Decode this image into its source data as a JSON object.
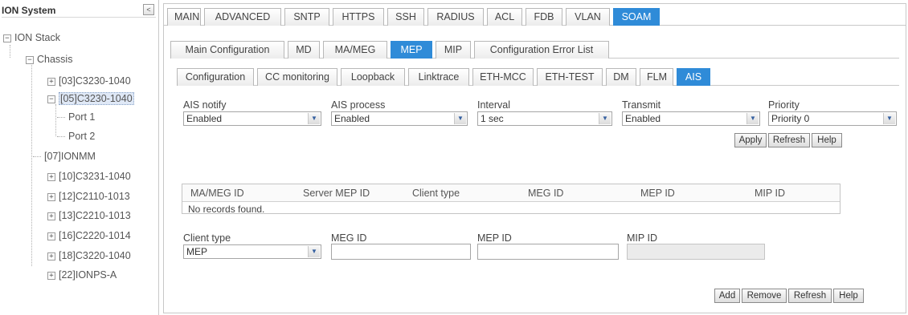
{
  "tree": {
    "title": "ION System",
    "collapse_icon": "<",
    "stack_label": "ION Stack",
    "chassis_label": "Chassis",
    "items": [
      {
        "label": "[03]C3230-1040",
        "expander": "+"
      },
      {
        "label": "[05]C3230-1040",
        "expander": "−",
        "selected": true
      },
      {
        "label": "Port 1"
      },
      {
        "label": "Port 2"
      },
      {
        "label": "[07]IONMM"
      },
      {
        "label": "[10]C3231-1040",
        "expander": "+"
      },
      {
        "label": "[12]C2110-1013",
        "expander": "+"
      },
      {
        "label": "[13]C2210-1013",
        "expander": "+"
      },
      {
        "label": "[16]C2220-1014",
        "expander": "+"
      },
      {
        "label": "[18]C3220-1040",
        "expander": "+"
      },
      {
        "label": "[22]IONPS-A",
        "expander": "+"
      }
    ]
  },
  "top_tabs": [
    "MAIN",
    "ADVANCED",
    "SNTP",
    "HTTPS",
    "SSH",
    "RADIUS",
    "ACL",
    "FDB",
    "VLAN",
    "SOAM"
  ],
  "top_tabs_active": "SOAM",
  "sub_tabs": [
    "Main Configuration",
    "MD",
    "MA/MEG",
    "MEP",
    "MIP",
    "Configuration Error List"
  ],
  "sub_tabs_active": "MEP",
  "mep_tabs": [
    "Configuration",
    "CC monitoring",
    "Loopback",
    "Linktrace",
    "ETH-MCC",
    "ETH-TEST",
    "DM",
    "FLM",
    "AIS"
  ],
  "mep_tabs_active": "AIS",
  "ais_form": {
    "ais_notify": {
      "label": "AIS notify",
      "value": "Enabled"
    },
    "ais_process": {
      "label": "AIS process",
      "value": "Enabled"
    },
    "interval": {
      "label": "Interval",
      "value": "1 sec"
    },
    "transmit": {
      "label": "Transmit",
      "value": "Enabled"
    },
    "priority": {
      "label": "Priority",
      "value": "Priority 0"
    },
    "buttons": {
      "apply": "Apply",
      "refresh": "Refresh",
      "help": "Help"
    }
  },
  "records_table": {
    "columns": [
      "MA/MEG ID",
      "Server MEP ID",
      "Client type",
      "MEG ID",
      "MEP ID",
      "MIP ID"
    ],
    "empty_text": "No records found."
  },
  "add_form": {
    "client_type": {
      "label": "Client type",
      "value": "MEP"
    },
    "meg_id": {
      "label": "MEG ID",
      "value": ""
    },
    "mep_id": {
      "label": "MEP ID",
      "value": ""
    },
    "mip_id": {
      "label": "MIP ID",
      "value": ""
    },
    "buttons": {
      "add": "Add",
      "remove": "Remove",
      "refresh": "Refresh",
      "help": "Help"
    }
  },
  "colors": {
    "active_tab": "#2f8bd8",
    "selected_tree": "#dfe8f6"
  }
}
